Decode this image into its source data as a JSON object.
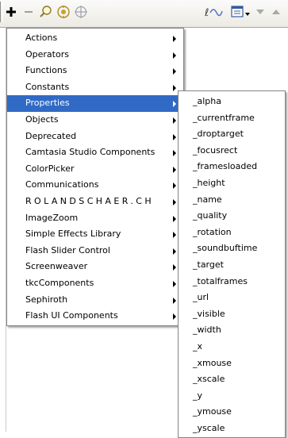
{
  "toolbar": {
    "add_icon": "plus-icon",
    "remove_icon": "minus-icon",
    "find_icon": "magnifier-icon",
    "insert_target_icon": "target-path-icon",
    "crosshair_icon": "crosshair-icon",
    "debug_icon": "code-hint-icon",
    "view_options_icon": "view-options-icon",
    "scroll_down_icon": "arrow-down-icon",
    "scroll_up_icon": "arrow-up-icon"
  },
  "menu": {
    "items": [
      {
        "label": "Actions",
        "has_submenu": true
      },
      {
        "label": "Operators",
        "has_submenu": true
      },
      {
        "label": "Functions",
        "has_submenu": true
      },
      {
        "label": "Constants",
        "has_submenu": true
      },
      {
        "label": "Properties",
        "has_submenu": true,
        "selected": true
      },
      {
        "label": "Objects",
        "has_submenu": true
      },
      {
        "label": "Deprecated",
        "has_submenu": true
      },
      {
        "label": "Camtasia Studio Components",
        "has_submenu": true
      },
      {
        "label": "ColorPicker",
        "has_submenu": true
      },
      {
        "label": "Communications",
        "has_submenu": true
      },
      {
        "label": "ROLANDSCHAER.CH",
        "has_submenu": true
      },
      {
        "label": "ImageZoom",
        "has_submenu": true
      },
      {
        "label": "Simple Effects Library",
        "has_submenu": true
      },
      {
        "label": "Flash Slider Control",
        "has_submenu": true
      },
      {
        "label": "Screenweaver",
        "has_submenu": true
      },
      {
        "label": "tkcComponents",
        "has_submenu": true
      },
      {
        "label": "Sephiroth",
        "has_submenu": true
      },
      {
        "label": "Flash UI Components",
        "has_submenu": true
      }
    ]
  },
  "submenu": {
    "items": [
      "_alpha",
      "_currentframe",
      "_droptarget",
      "_focusrect",
      "_framesloaded",
      "_height",
      "_name",
      "_quality",
      "_rotation",
      "_soundbuftime",
      "_target",
      "_totalframes",
      "_url",
      "_visible",
      "_width",
      "_x",
      "_xmouse",
      "_xscale",
      "_y",
      "_ymouse",
      "_yscale"
    ]
  },
  "colors": {
    "selection_bg": "#316ac5",
    "selection_text": "#ffffff",
    "toolbar_bg": "#eceae3",
    "menu_border": "#848484"
  }
}
